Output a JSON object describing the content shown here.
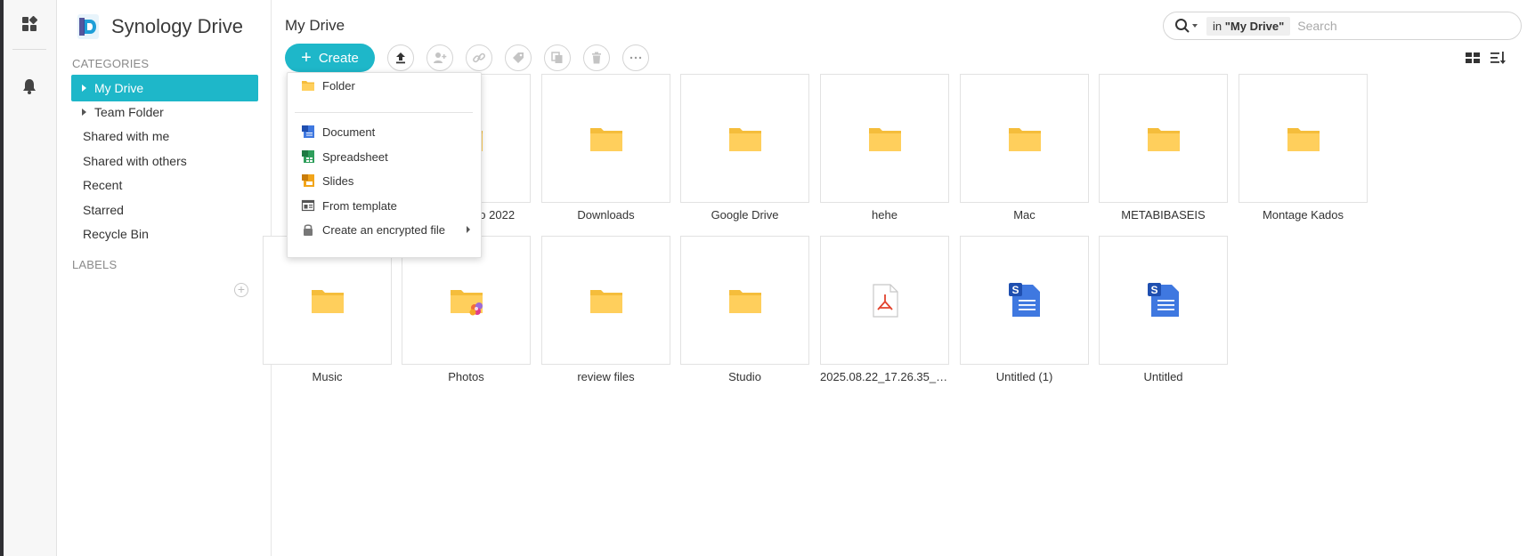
{
  "app": {
    "brand_name": "Synology Drive"
  },
  "sidebar": {
    "categories_title": "CATEGORIES",
    "labels_title": "LABELS",
    "items": [
      {
        "label": "My Drive",
        "active": true,
        "expandable": true
      },
      {
        "label": "Team Folder",
        "active": false,
        "expandable": true
      },
      {
        "label": "Shared with me"
      },
      {
        "label": "Shared with others"
      },
      {
        "label": "Recent"
      },
      {
        "label": "Starred"
      },
      {
        "label": "Recycle Bin"
      }
    ]
  },
  "main": {
    "title": "My Drive",
    "create_label": "Create",
    "search": {
      "scope_prefix": "in ",
      "scope_value": "\"My Drive\"",
      "placeholder": "Search"
    }
  },
  "create_menu": {
    "items": [
      {
        "label": "Folder",
        "icon": "folder-icon"
      },
      {
        "label": "Document",
        "icon": "document-icon"
      },
      {
        "label": "Spreadsheet",
        "icon": "spreadsheet-icon"
      },
      {
        "label": "Slides",
        "icon": "slides-icon"
      },
      {
        "label": "From template",
        "icon": "template-icon"
      },
      {
        "label": "Create an encrypted file",
        "icon": "lock-icon",
        "has_submenu": true
      }
    ]
  },
  "files": [
    {
      "name": "Premiere Pro 2022",
      "type": "folder"
    },
    {
      "name": "Downloads",
      "type": "folder"
    },
    {
      "name": "Google Drive",
      "type": "folder"
    },
    {
      "name": "hehe",
      "type": "folder"
    },
    {
      "name": "Mac",
      "type": "folder"
    },
    {
      "name": "METABIBASEIS",
      "type": "folder"
    },
    {
      "name": "Montage Kados",
      "type": "folder"
    },
    {
      "name": "Music",
      "type": "folder"
    },
    {
      "name": "Photos",
      "type": "photos-folder"
    },
    {
      "name": "review files",
      "type": "folder"
    },
    {
      "name": "Studio",
      "type": "folder"
    },
    {
      "name": "2025.08.22_17.26.35_E…",
      "type": "pdf"
    },
    {
      "name": "Untitled (1)",
      "type": "synology-doc"
    },
    {
      "name": "Untitled",
      "type": "synology-doc"
    }
  ],
  "colors": {
    "accent": "#1eb7c9",
    "folder": "#ffcf5c",
    "doc_blue": "#3f78e0"
  }
}
